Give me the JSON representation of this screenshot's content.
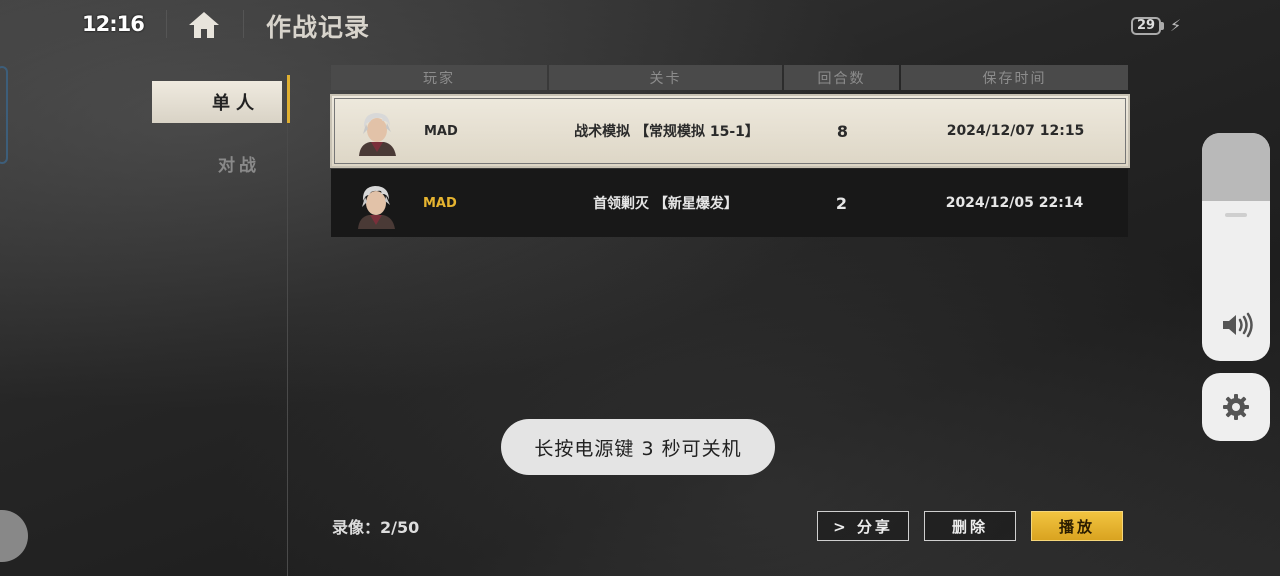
{
  "status_bar": {
    "time": "12:16",
    "battery": "29"
  },
  "header": {
    "title": "作战记录"
  },
  "sidebar": {
    "tabs": [
      {
        "label": "单人",
        "active": true
      },
      {
        "label": "对战",
        "active": false
      }
    ]
  },
  "table": {
    "columns": [
      "玩家",
      "关卡",
      "回合数",
      "保存时间"
    ],
    "rows": [
      {
        "player": "MAD",
        "stage": "战术模拟 【常规模拟 15-1】",
        "rounds": "8",
        "saved_time": "2024/12/07 12:15",
        "selected": true
      },
      {
        "player": "MAD",
        "stage": "首领剿灭 【新星爆发】",
        "rounds": "2",
        "saved_time": "2024/12/05 22:14",
        "selected": false
      }
    ]
  },
  "toast": {
    "message": "长按电源键 3 秒可关机"
  },
  "footer": {
    "recording_count": "录像：2/50",
    "share_label": "> 分享",
    "delete_label": "删除",
    "play_label": "播放"
  },
  "colors": {
    "accent": "#e6b430",
    "selected_row_bg": "#eee9dd",
    "row_bg": "#181818",
    "header_bg": "#4a4a4a"
  },
  "icons": {
    "home": "home-icon",
    "volume": "speaker-icon",
    "settings": "gear-icon",
    "charging": "bolt-icon"
  }
}
